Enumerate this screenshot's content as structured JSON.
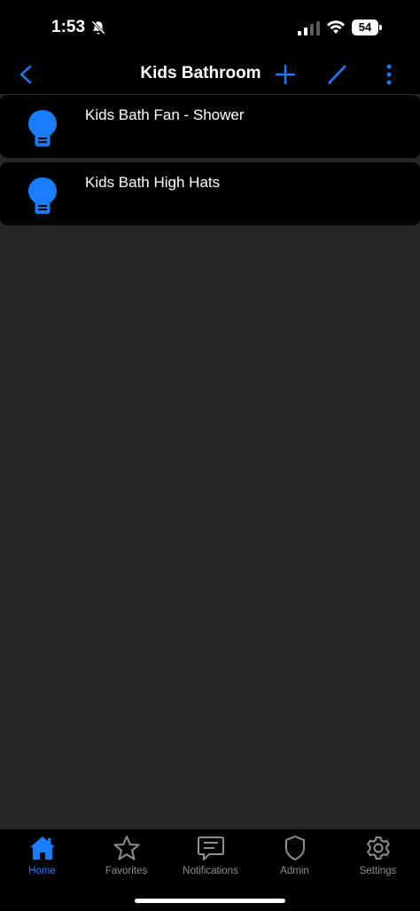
{
  "status_bar": {
    "time": "1:53",
    "battery": "54",
    "icons": [
      "bell-slash-icon",
      "cellular-signal-icon",
      "wifi-icon",
      "battery-icon"
    ]
  },
  "nav": {
    "title": "Kids Bathroom",
    "icons": [
      "chevron-left-icon",
      "plus-icon",
      "pencil-icon",
      "more-vertical-icon"
    ]
  },
  "devices": [
    {
      "label": "Kids Bath Fan - Shower",
      "icon": "lightbulb-icon"
    },
    {
      "label": "Kids Bath High Hats",
      "icon": "lightbulb-icon"
    }
  ],
  "tabs": [
    {
      "label": "Home",
      "icon": "house-icon",
      "active": true
    },
    {
      "label": "Favorites",
      "icon": "star-icon",
      "active": false
    },
    {
      "label": "Notifications",
      "icon": "message-icon",
      "active": false
    },
    {
      "label": "Admin",
      "icon": "shield-icon",
      "active": false
    },
    {
      "label": "Settings",
      "icon": "gear-icon",
      "active": false
    }
  ],
  "colors": {
    "accent": "#1a7cff",
    "background": "#262626",
    "bar": "#000000",
    "inactive": "#8e8e93"
  }
}
